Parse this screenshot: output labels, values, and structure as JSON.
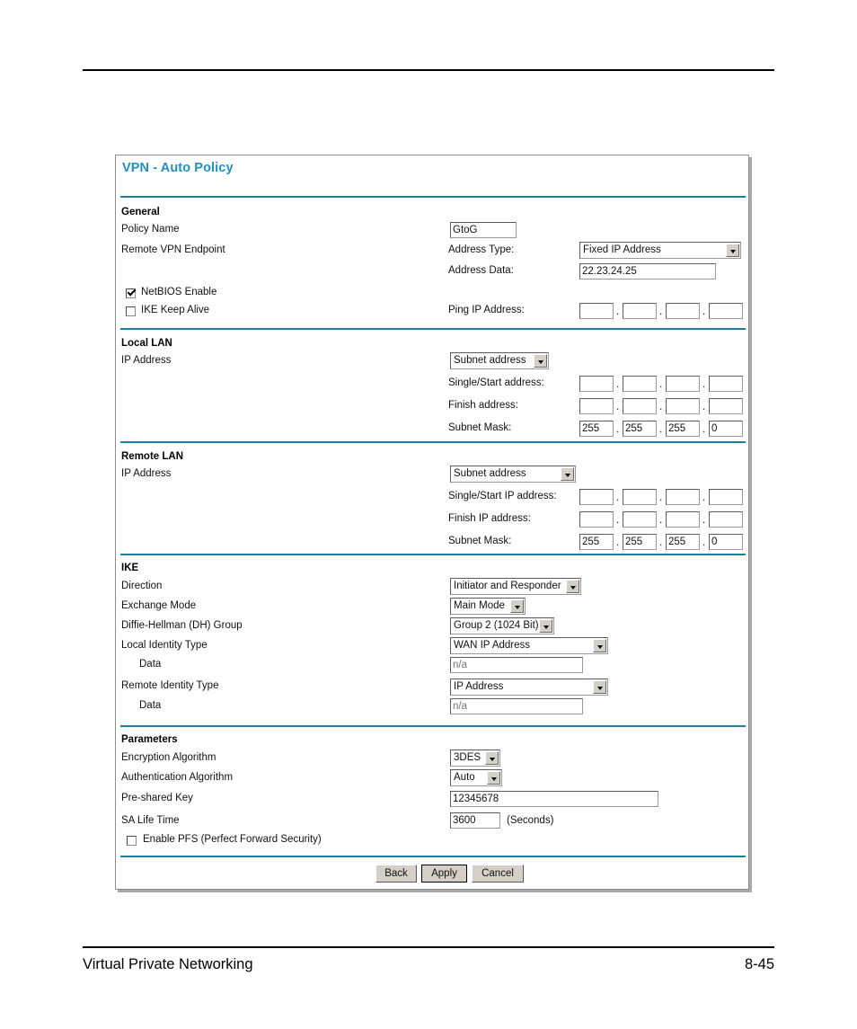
{
  "document": {
    "footer_left": "Virtual Private Networking",
    "footer_page": "8-45"
  },
  "panel": {
    "title": "VPN - Auto Policy",
    "accent_color": "#1f92c0",
    "rule_color": "#1f7f9e"
  },
  "general": {
    "heading": "General",
    "policy_name_label": "Policy Name",
    "policy_name_value": "GtoG",
    "remote_endpoint_label": "Remote VPN Endpoint",
    "address_type_label": "Address Type:",
    "address_type_value": "Fixed IP Address",
    "address_data_label": "Address Data:",
    "address_data_value": "22.23.24.25",
    "netbios_label": "NetBIOS Enable",
    "netbios_checked": true,
    "ike_keep_alive_label": "IKE Keep Alive",
    "ike_keep_alive_checked": false,
    "ping_ip_label": "Ping IP Address:",
    "ping_ip_octets": [
      "",
      "",
      "",
      ""
    ]
  },
  "local_lan": {
    "heading": "Local LAN",
    "ip_address_label": "IP Address",
    "ip_address_type": "Subnet address",
    "start_label": "Single/Start address:",
    "start_octets": [
      "",
      "",
      "",
      ""
    ],
    "finish_label": "Finish address:",
    "finish_octets": [
      "",
      "",
      "",
      ""
    ],
    "mask_label": "Subnet Mask:",
    "mask_octets": [
      "255",
      "255",
      "255",
      "0"
    ]
  },
  "remote_lan": {
    "heading": "Remote LAN",
    "ip_address_label": "IP Address",
    "ip_address_type": "Subnet address",
    "start_label": "Single/Start IP address:",
    "start_octets": [
      "",
      "",
      "",
      ""
    ],
    "finish_label": "Finish IP address:",
    "finish_octets": [
      "",
      "",
      "",
      ""
    ],
    "mask_label": "Subnet Mask:",
    "mask_octets": [
      "255",
      "255",
      "255",
      "0"
    ]
  },
  "ike": {
    "heading": "IKE",
    "direction_label": "Direction",
    "direction_value": "Initiator and Responder",
    "exchange_mode_label": "Exchange Mode",
    "exchange_mode_value": "Main Mode",
    "dh_group_label": "Diffie-Hellman (DH) Group",
    "dh_group_value": "Group 2 (1024 Bit)",
    "local_identity_label": "Local Identity Type",
    "local_identity_value": "WAN IP Address",
    "local_data_label": "Data",
    "local_data_value": "n/a",
    "remote_identity_label": "Remote Identity Type",
    "remote_identity_value": "IP Address",
    "remote_data_label": "Data",
    "remote_data_value": "n/a"
  },
  "parameters": {
    "heading": "Parameters",
    "encryption_label": "Encryption Algorithm",
    "encryption_value": "3DES",
    "authentication_label": "Authentication Algorithm",
    "authentication_value": "Auto",
    "psk_label": "Pre-shared Key",
    "psk_value": "12345678",
    "sa_life_label": "SA Life Time",
    "sa_life_value": "3600",
    "sa_life_units": "(Seconds)",
    "pfs_label": "Enable PFS (Perfect Forward Security)",
    "pfs_checked": false
  },
  "actions": {
    "back": "Back",
    "apply": "Apply",
    "cancel": "Cancel"
  }
}
